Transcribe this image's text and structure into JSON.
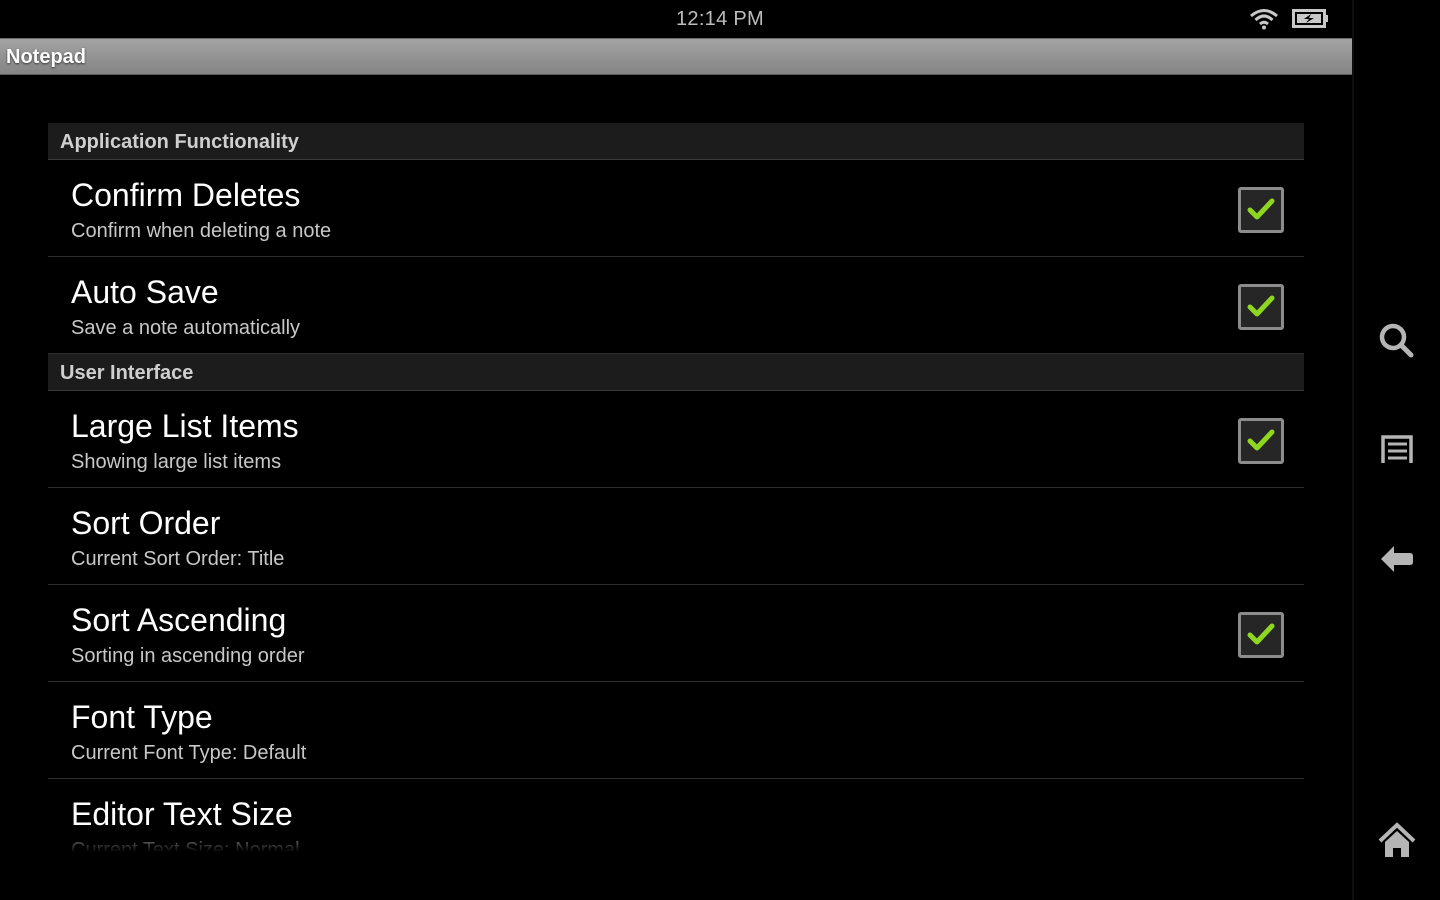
{
  "status_bar": {
    "time": "12:14 PM",
    "icons": [
      "wifi-icon",
      "battery-charging-icon"
    ]
  },
  "app": {
    "title": "Notepad"
  },
  "preferences": {
    "categories": [
      {
        "title": "Application Functionality",
        "items": [
          {
            "title": "Confirm Deletes",
            "summary": "Confirm when deleting a note",
            "type": "checkbox",
            "checked": true
          },
          {
            "title": "Auto Save",
            "summary": "Save a note automatically",
            "type": "checkbox",
            "checked": true
          }
        ]
      },
      {
        "title": "User Interface",
        "items": [
          {
            "title": "Large List Items",
            "summary": "Showing large list items",
            "type": "checkbox",
            "checked": true
          },
          {
            "title": "Sort Order",
            "summary": "Current Sort Order: Title",
            "type": "list"
          },
          {
            "title": "Sort Ascending",
            "summary": "Sorting in ascending order",
            "type": "checkbox",
            "checked": true
          },
          {
            "title": "Font Type",
            "summary": "Current Font Type: Default",
            "type": "list"
          },
          {
            "title": "Editor Text Size",
            "summary": "Current Text Size: Normal",
            "type": "list"
          }
        ]
      }
    ]
  },
  "nav_bar": {
    "buttons": [
      "search-icon",
      "menu-icon",
      "back-icon",
      "home-icon"
    ]
  },
  "colors": {
    "check_accent": "#8fd61e",
    "titlebar": "#959595",
    "background": "#000000"
  }
}
